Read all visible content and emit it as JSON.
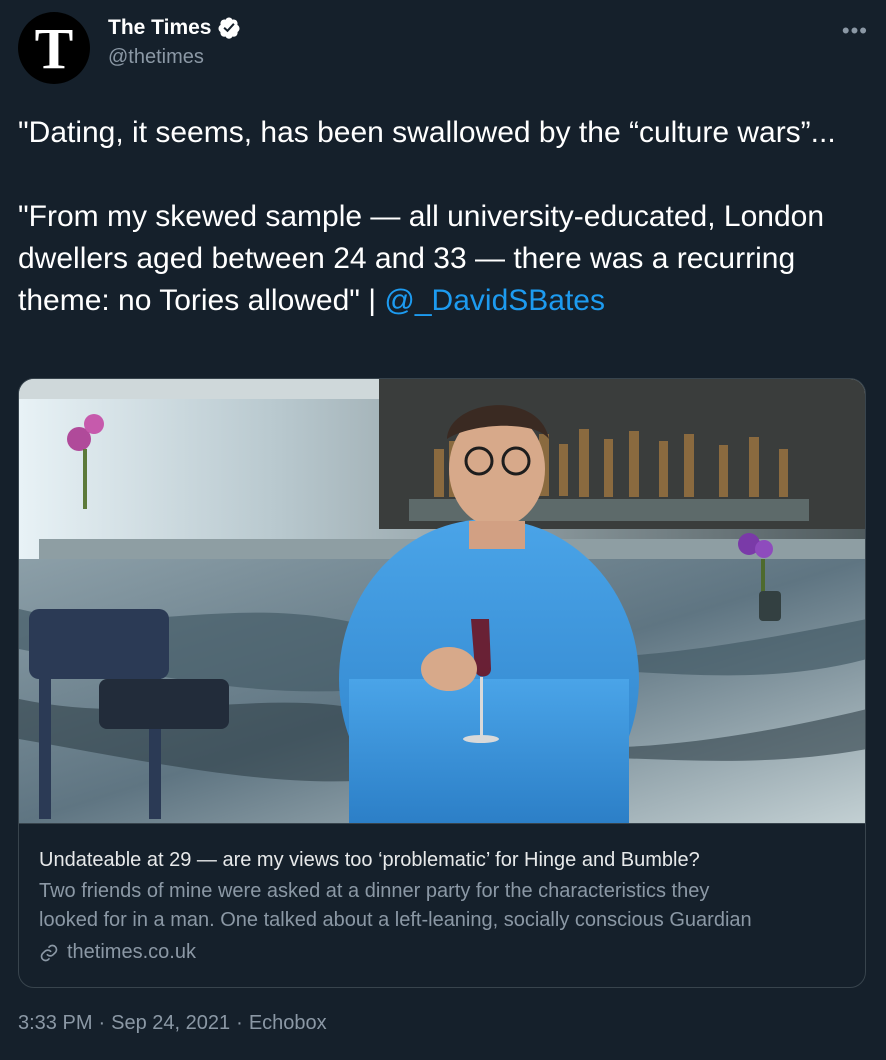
{
  "author": {
    "avatar_letter": "T",
    "display_name": "The Times",
    "handle": "@thetimes",
    "verified_icon": "verified-badge-icon"
  },
  "more_label": "•••",
  "tweet": {
    "text": "\"Dating, it seems, has been swallowed by the “culture wars”...\n\n\"From my skewed sample — all university-educated, London dwellers aged between 24 and 33 — there was a recurring theme: no Tories allowed\" | ",
    "mention": "@_DavidSBates"
  },
  "card": {
    "title": "Undateable at 29 — are my views too ‘problematic’ for Hinge and Bumble?",
    "description_line1": "Two friends of mine were asked at a dinner party for the characteristics they",
    "description_line2": "looked for in a man. One talked about a left-leaning, socially conscious Guardian",
    "domain": "thetimes.co.uk",
    "image_alt": "Man in blue shirt holding a glass of red wine at a marble bar"
  },
  "meta": {
    "time": "3:33 PM",
    "separator": "·",
    "date": "Sep 24, 2021",
    "source": "Echobox"
  },
  "colors": {
    "background": "#15202b",
    "accent": "#1d9bf0",
    "secondary_text": "#8b98a5",
    "border": "#38444d"
  }
}
